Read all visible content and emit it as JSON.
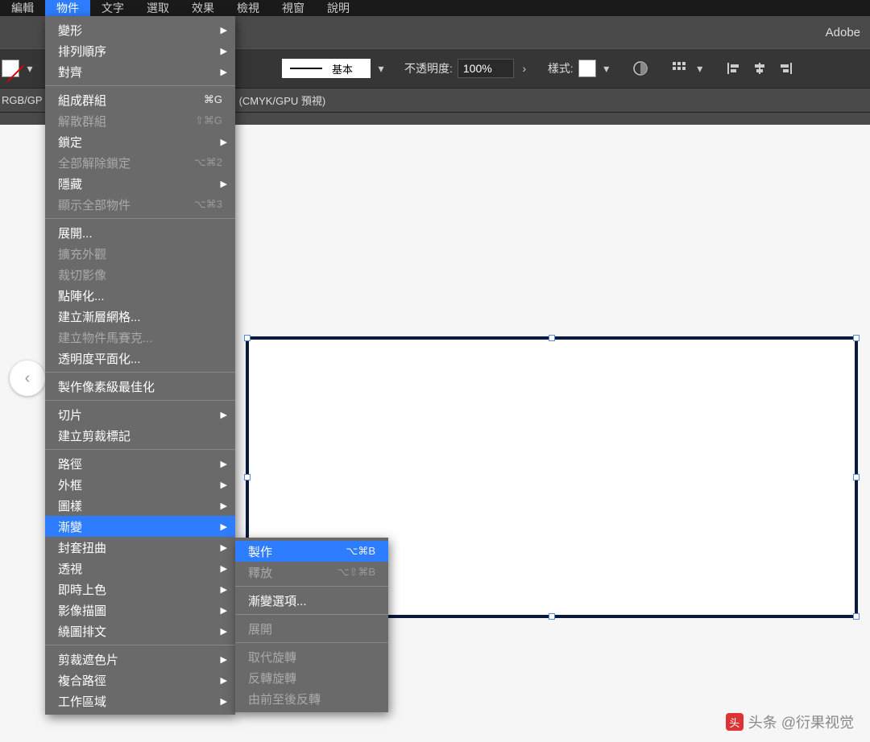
{
  "menubar": {
    "items": [
      "編輯",
      "物件",
      "文字",
      "選取",
      "效果",
      "檢視",
      "視窗",
      "說明"
    ],
    "active_index": 1
  },
  "titlebar": {
    "brand": "Adobe"
  },
  "toolbar": {
    "stroke_style": "基本",
    "opacity_label": "不透明度:",
    "opacity_value": "100%",
    "style_label": "樣式:"
  },
  "tabbar": {
    "left_doc": "RGB/GP",
    "right_doc": "(CMYK/GPU 預視)"
  },
  "dropdown": {
    "groups": [
      [
        {
          "label": "變形",
          "arrow": true
        },
        {
          "label": "排列順序",
          "arrow": true
        },
        {
          "label": "對齊",
          "arrow": true
        }
      ],
      [
        {
          "label": "組成群組",
          "shortcut": "⌘G"
        },
        {
          "label": "解散群組",
          "shortcut": "⇧⌘G",
          "disabled": true
        },
        {
          "label": "鎖定",
          "arrow": true
        },
        {
          "label": "全部解除鎖定",
          "shortcut": "⌥⌘2",
          "disabled": true
        },
        {
          "label": "隱藏",
          "arrow": true
        },
        {
          "label": "顯示全部物件",
          "shortcut": "⌥⌘3",
          "disabled": true
        }
      ],
      [
        {
          "label": "展開..."
        },
        {
          "label": "擴充外觀",
          "disabled": true
        },
        {
          "label": "裁切影像",
          "disabled": true
        },
        {
          "label": "點陣化..."
        },
        {
          "label": "建立漸層網格..."
        },
        {
          "label": "建立物件馬賽克...",
          "disabled": true
        },
        {
          "label": "透明度平面化..."
        }
      ],
      [
        {
          "label": "製作像素級最佳化"
        }
      ],
      [
        {
          "label": "切片",
          "arrow": true
        },
        {
          "label": "建立剪裁標記"
        }
      ],
      [
        {
          "label": "路徑",
          "arrow": true
        },
        {
          "label": "外框",
          "arrow": true
        },
        {
          "label": "圖樣",
          "arrow": true
        },
        {
          "label": "漸變",
          "arrow": true,
          "highlight": true
        },
        {
          "label": "封套扭曲",
          "arrow": true
        },
        {
          "label": "透視",
          "arrow": true
        },
        {
          "label": "即時上色",
          "arrow": true
        },
        {
          "label": "影像描圖",
          "arrow": true
        },
        {
          "label": "繞圖排文",
          "arrow": true
        }
      ],
      [
        {
          "label": "剪裁遮色片",
          "arrow": true
        },
        {
          "label": "複合路徑",
          "arrow": true
        },
        {
          "label": "工作區域",
          "arrow": true
        }
      ]
    ]
  },
  "submenu": {
    "groups": [
      [
        {
          "label": "製作",
          "shortcut": "⌥⌘B",
          "highlight": true
        },
        {
          "label": "釋放",
          "shortcut": "⌥⇧⌘B",
          "disabled": true
        }
      ],
      [
        {
          "label": "漸變選項..."
        }
      ],
      [
        {
          "label": "展開",
          "disabled": true
        }
      ],
      [
        {
          "label": "取代旋轉",
          "disabled": true
        },
        {
          "label": "反轉旋轉",
          "disabled": true
        },
        {
          "label": "由前至後反轉",
          "disabled": true
        }
      ]
    ]
  },
  "watermark": {
    "text": "头条 @衍果视觉",
    "icon_label": "头"
  }
}
